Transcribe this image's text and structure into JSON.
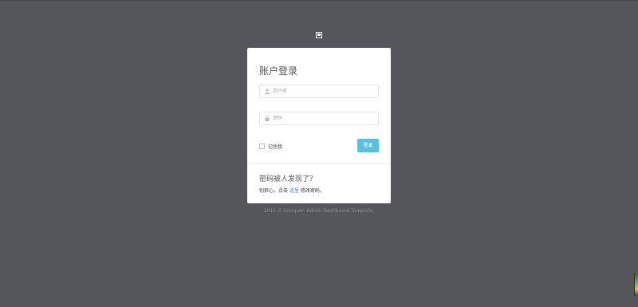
{
  "login": {
    "title": "账户登录",
    "username_placeholder": "用户名",
    "password_placeholder": "密码",
    "remember_label": "记住我",
    "login_button": "登录"
  },
  "forgot": {
    "title": "密码被人发现了？",
    "text_prefix": "别担心，点击",
    "link_text": "这里",
    "text_suffix": "修改密码。"
  },
  "footer": {
    "copyright": "2013 © Conquer. Admin Dashboard Template."
  },
  "colors": {
    "background": "#55565b",
    "button": "#5bc0de",
    "link": "#337ab7"
  },
  "icons": {
    "logo": "logo-icon",
    "username": "user-icon",
    "password": "lock-icon"
  }
}
